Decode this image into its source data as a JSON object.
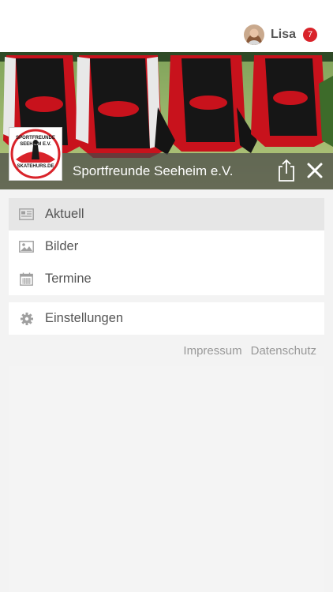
{
  "header": {
    "user_name": "Lisa",
    "notification_count": "7",
    "avatar_icon": "user-avatar-photo"
  },
  "club": {
    "name": "Sportfreunde Seeheim e.V.",
    "logo_lines": [
      "SPORTFREUNDE",
      "SEEHEIM E.V.",
      "SKATEHURS.DE"
    ]
  },
  "menu": {
    "items": [
      {
        "label": "Aktuell",
        "icon": "news-icon",
        "active": true
      },
      {
        "label": "Bilder",
        "icon": "image-icon",
        "active": false
      },
      {
        "label": "Termine",
        "icon": "calendar-icon",
        "active": false
      }
    ],
    "settings": {
      "label": "Einstellungen",
      "icon": "gear-icon"
    }
  },
  "footer": {
    "impressum": "Impressum",
    "datenschutz": "Datenschutz"
  },
  "colors": {
    "accent": "#d9232a",
    "text": "#555555",
    "muted": "#999999"
  }
}
